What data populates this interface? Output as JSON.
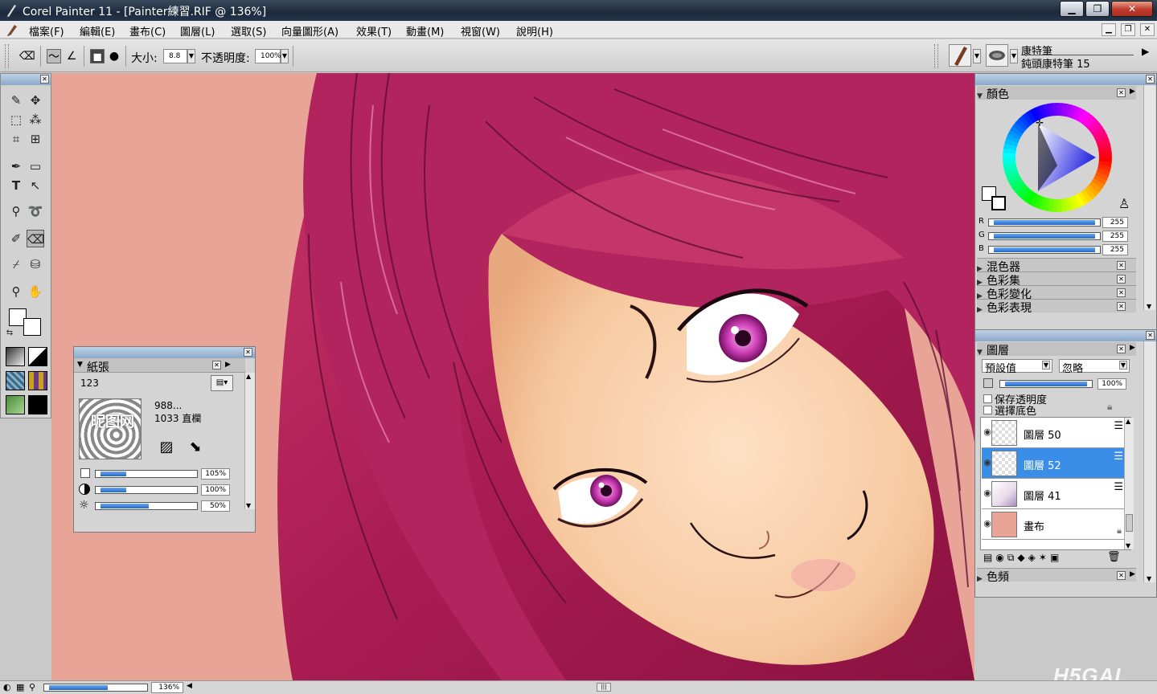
{
  "window": {
    "title": "Corel Painter 11 - [Painter練習.RIF @ 136%]",
    "min": "▁",
    "max": "❐",
    "close": "✕"
  },
  "menu": [
    "檔案(F)",
    "編輯(E)",
    "畫布(C)",
    "圖層(L)",
    "選取(S)",
    "向量圖形(A)",
    "效果(T)",
    "動畫(M)",
    "視窗(W)",
    "說明(H)"
  ],
  "propbar": {
    "size_label": "大小:",
    "size_value": "8.8",
    "opacity_label": "不透明度:",
    "opacity_value": "100%",
    "brush_category": "康特筆",
    "brush_variant": "鈍頭康特筆 15"
  },
  "papers": {
    "title": "紙張",
    "paper_name": "123",
    "paper_size": "988...",
    "paper_detail": "1033 直欄",
    "scale": "105%",
    "contrast": "100%",
    "brightness": "50%",
    "scale_frac": 0.28,
    "contrast_frac": 0.28,
    "brightness_frac": 0.52,
    "preview_text": "昵图网"
  },
  "colors": {
    "title": "顏色",
    "r_label": "R",
    "g_label": "G",
    "b_label": "B",
    "r_value": "255",
    "g_value": "255",
    "b_value": "255",
    "sections": [
      "混色器",
      "色彩集",
      "色彩變化",
      "色彩表現"
    ]
  },
  "layers": {
    "title": "圖層",
    "composite_method": "預設值",
    "composite_depth": "忽略",
    "opacity": "100%",
    "preserve_transparency": "保存透明度",
    "pick_up_underlying": "選擇底色",
    "items": [
      {
        "name": "圖層 50",
        "selected": false
      },
      {
        "name": "圖層 52",
        "selected": true
      },
      {
        "name": "圖層 41",
        "selected": false
      },
      {
        "name": "畫布",
        "selected": false
      }
    ],
    "channels_title": "色頻"
  },
  "status": {
    "zoom": "136%",
    "zoom_frac": 0.62
  },
  "watermark": "H5GAL",
  "colors_accent": {
    "canvas_bg": "#e8a496",
    "hair": "#b0225a",
    "skin": "#f6cba4",
    "panel_head": "#8ca8c8",
    "slider_blue": "#2268c8",
    "selected_layer": "#3a8ee8"
  }
}
